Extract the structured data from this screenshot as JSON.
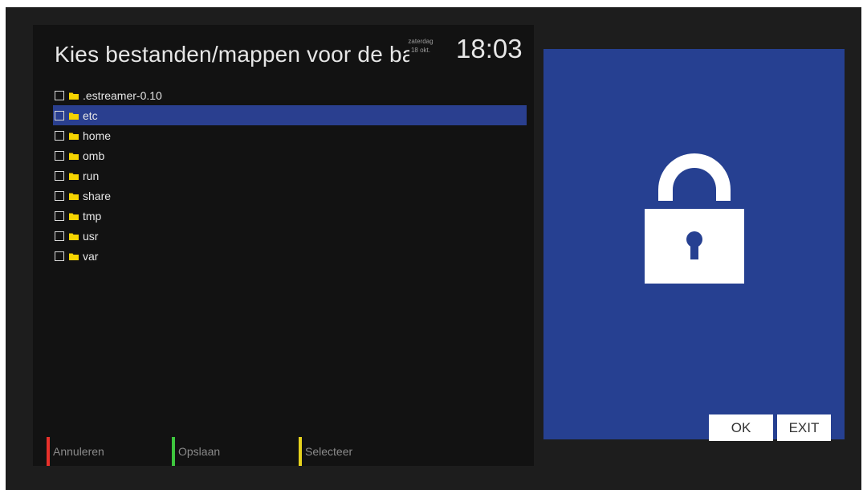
{
  "header": {
    "title": "Kies bestanden/mappen voor de backup",
    "day": "zaterdag",
    "date": "18 okt.",
    "time": "18:03"
  },
  "file_list": [
    {
      "name": ".estreamer-0.10",
      "checked": false,
      "selected": false
    },
    {
      "name": "etc",
      "checked": false,
      "selected": true
    },
    {
      "name": "home",
      "checked": false,
      "selected": false
    },
    {
      "name": "omb",
      "checked": false,
      "selected": false
    },
    {
      "name": "run",
      "checked": false,
      "selected": false
    },
    {
      "name": "share",
      "checked": false,
      "selected": false
    },
    {
      "name": "tmp",
      "checked": false,
      "selected": false
    },
    {
      "name": "usr",
      "checked": false,
      "selected": false
    },
    {
      "name": "var",
      "checked": false,
      "selected": false
    }
  ],
  "side_panel": {
    "icon": "lock-icon",
    "ok_label": "OK",
    "exit_label": "EXIT"
  },
  "footer": {
    "red_label": "Annuleren",
    "green_label": "Opslaan",
    "yellow_label": "Selecteer"
  },
  "colors": {
    "selection": "#2a3f8f",
    "panel_blue": "#264091",
    "folder": "#f5d400",
    "red": "#e8312b",
    "green": "#3ec63e",
    "yellow": "#e6d21d"
  }
}
